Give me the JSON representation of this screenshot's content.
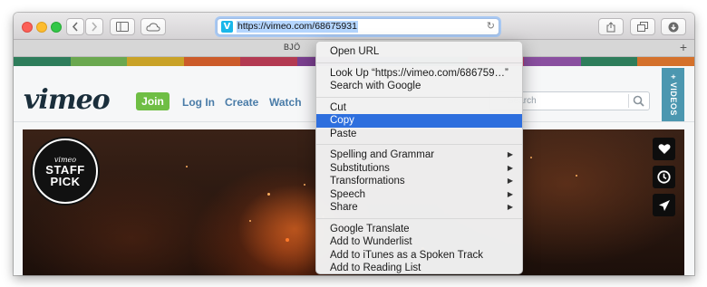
{
  "browser": {
    "url": "https://vimeo.com/68675931",
    "favicon_letter": "V",
    "tab_title": "BJÖ",
    "new_tab_symbol": "+"
  },
  "site": {
    "logo": "vimeo",
    "join": "Join",
    "login": "Log In",
    "create": "Create",
    "watch": "Watch",
    "search_placeholder": "Search",
    "videos_tab": "+ VIDEOS",
    "stripe_colors": [
      "#2e7d5b",
      "#6aa84f",
      "#c9a227",
      "#cc5b2a",
      "#b33a52",
      "#7a3f8f",
      "#3d6fb0",
      "#2f9aa3",
      "#c23a6a",
      "#8a4fa0",
      "#2e7d5b",
      "#d4712c"
    ]
  },
  "hero": {
    "badge_brand": "vimeo",
    "badge_line1": "STAFF",
    "badge_line2": "PICK"
  },
  "context_menu": {
    "groups": [
      [
        "Open URL"
      ],
      [
        "Look Up “https://vimeo.com/686759…”",
        "Search with Google"
      ],
      [
        "Cut",
        "Copy",
        "Paste"
      ],
      [
        "Spelling and Grammar",
        "Substitutions",
        "Transformations",
        "Speech",
        "Share"
      ],
      [
        "Google Translate",
        "Add to Wunderlist",
        "Add to iTunes as a Spoken Track",
        "Add to Reading List"
      ]
    ],
    "selected_item": "Copy",
    "submenu_items": [
      "Spelling and Grammar",
      "Substitutions",
      "Transformations",
      "Speech",
      "Share"
    ],
    "selection_color": "#2e6fde"
  },
  "colors": {
    "brand_blue": "#1ab7ea",
    "join_green": "#6fbe44",
    "videos_tab": "#4c97b0"
  }
}
